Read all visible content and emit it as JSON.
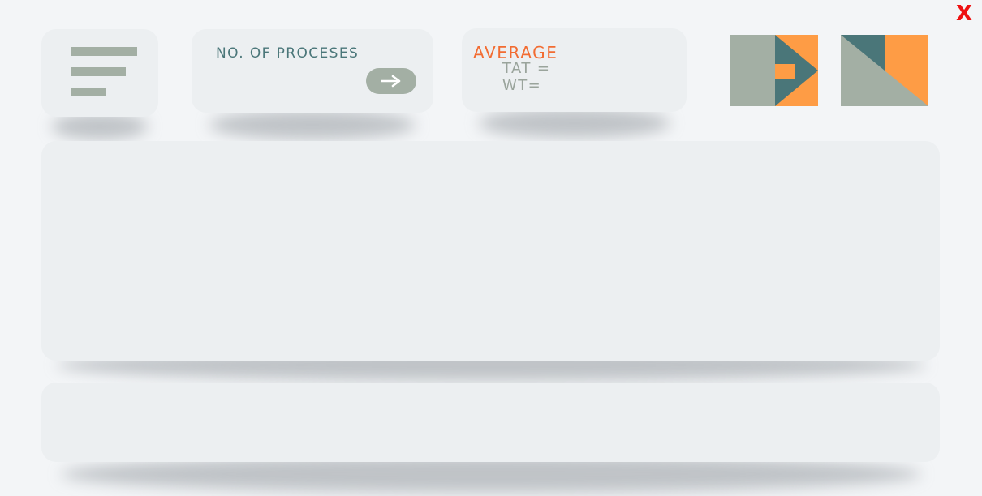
{
  "window": {
    "close_label": "X"
  },
  "menu": {
    "icon": "hamburger-menu-icon"
  },
  "processes": {
    "label": "NO. OF PROCESES",
    "submit_icon": "arrow-right-icon"
  },
  "average": {
    "title": "AVERAGE",
    "tat_label": "TAT =",
    "wt_label": "WT="
  },
  "logos": [
    {
      "icon": "play-forward-logo-icon"
    },
    {
      "icon": "angular-n-logo-icon"
    }
  ],
  "colors": {
    "sage": "#a3afa4",
    "teal": "#4a7679",
    "orange": "#fe9c45",
    "accent_orange": "#f26c32",
    "close_red": "#ee1111",
    "card": "#eceff1",
    "background": "#f3f5f7"
  }
}
